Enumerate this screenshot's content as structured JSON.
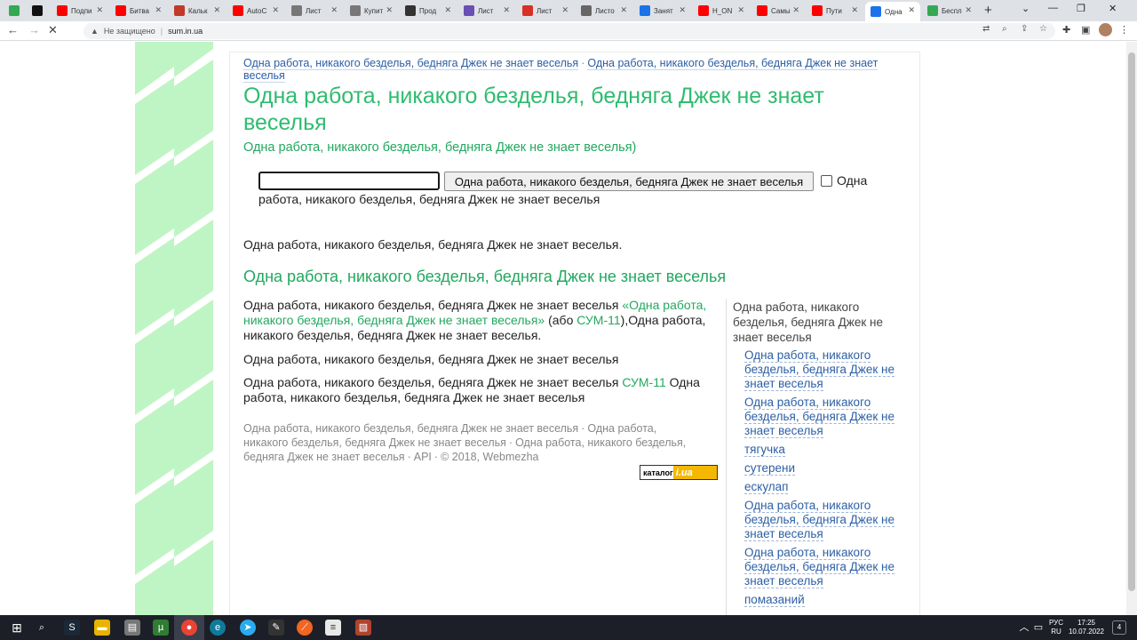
{
  "browser": {
    "tabs": [
      {
        "label": "",
        "favicon": "drive-icon",
        "color": "#34a853"
      },
      {
        "label": "",
        "favicon": "dou-icon",
        "color": "#111111"
      },
      {
        "label": "Подпи",
        "favicon": "youtube-icon",
        "color": "#ff0000"
      },
      {
        "label": "Битва",
        "favicon": "youtube-icon",
        "color": "#ff0000"
      },
      {
        "label": "Кальк",
        "favicon": "m-icon",
        "color": "#c0392b"
      },
      {
        "label": "AutoC",
        "favicon": "youtube-icon",
        "color": "#ff0000"
      },
      {
        "label": "Лист",
        "favicon": "puzzle-icon",
        "color": "#777777"
      },
      {
        "label": "Купит",
        "favicon": "puzzle-icon",
        "color": "#777777"
      },
      {
        "label": "Прод",
        "favicon": "globe-icon",
        "color": "#333333"
      },
      {
        "label": "Лист",
        "favicon": "square-icon",
        "color": "#6a4fb5"
      },
      {
        "label": "Лист",
        "favicon": "t-icon",
        "color": "#d93025"
      },
      {
        "label": "Листо",
        "favicon": "tt-icon",
        "color": "#666666"
      },
      {
        "label": "Занят",
        "favicon": "pen-icon",
        "color": "#1a73e8"
      },
      {
        "label": "H_ON",
        "favicon": "youtube-icon",
        "color": "#ff0000"
      },
      {
        "label": "Самы",
        "favicon": "youtube-icon",
        "color": "#ff0000"
      },
      {
        "label": "Пути",
        "favicon": "youtube-icon",
        "color": "#ff0000"
      },
      {
        "label": "Одна",
        "favicon": "loading-icon",
        "color": "#1a73e8"
      },
      {
        "label": "Беспл",
        "favicon": "x-icon",
        "color": "#34a853"
      }
    ],
    "not_secure": "Не защищено",
    "url": "sum.in.ua"
  },
  "page": {
    "breadcrumb": [
      "Одна работа, никакого безделья, бедняга Джек не знает веселья",
      "Одна работа, никакого безделья, бедняга Джек не знает веселья"
    ],
    "title": "Одна работа, никакого безделья, бедняга Джек не знает веселья",
    "subtitle": "Одна работа, никакого безделья, бедняга Джек не знает веселья)",
    "search": {
      "value": "",
      "button_label": "Одна работа, никакого безделья, бедняга Джек не знает веселья",
      "checkbox_label_1": "Одна",
      "checkbox_label_2": "работа, никакого безделья, бедняга Джек не знает веселья"
    },
    "intro": "Одна работа, никакого безделья, бедняга Джек не знает веселья.",
    "section_heading": "Одна работа, никакого безделья, бедняга Джек не знает веселья",
    "para1": {
      "text_a": "Одна работа, никакого безделья, бедняга Джек не знает веселья ",
      "link": "«Одна работа, никакого безделья, бедняга Джек не знает веселья»",
      "text_b": " (або ",
      "link2": "СУМ-11",
      "text_c": "),Одна работа, никакого безделья, бедняга Джек не знает веселья."
    },
    "para2": "Одна работа, никакого безделья, бедняга Джек не знает веселья",
    "para3": {
      "text_a": "Одна работа, никакого безделья, бедняга Джек не знает веселья ",
      "link": "СУМ-11",
      "text_b": " Одна работа, никакого безделья, бедняга Джек не знает веселья"
    },
    "footer": {
      "item1": "Одна работа, никакого безделья, бедняга Джек не знает веселья",
      "item2": "Одна работа, никакого безделья, бедняга Джек не знает веселья",
      "item3": "Одна работа, никакого безделья, бедняга Джек не знает веселья",
      "api": "API",
      "copyright": "© 2018, Webmezha"
    },
    "badge": {
      "left": "каталог",
      "right": "i.ua"
    },
    "sidebar": {
      "heading": "Одна работа, никакого безделья, бедняга Джек не знает веселья",
      "items": [
        "Одна работа, никакого безделья, бедняга Джек не знает веселья",
        "Одна работа, никакого безделья, бедняга Джек не знает веселья",
        "тягучка",
        "сутерени",
        "ескулап",
        "Одна работа, никакого безделья, бедняга Джек не знает веселья",
        "Одна работа, никакого безделья, бедняга Джек не знает веселья",
        "помазаний"
      ]
    }
  },
  "taskbar": {
    "lang_top": "РУС",
    "lang_bottom": "RU",
    "time": "17:25",
    "date": "10.07.2022",
    "notifications": "4"
  }
}
